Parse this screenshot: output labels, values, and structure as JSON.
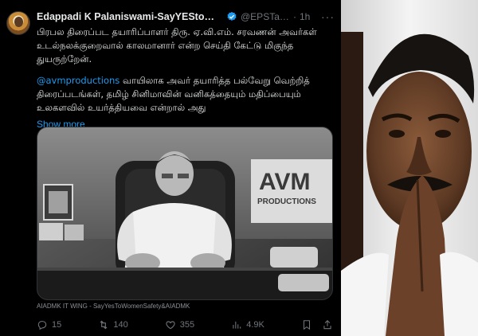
{
  "tweet": {
    "display_name": "Edappadi K Palaniswami-SayYEStoWomen...",
    "handle": "@EPSTam...",
    "separator": "·",
    "time": "1h",
    "more_icon": "more-horizontal-icon",
    "text_paragraph_1": "பிரபல திரைப்பட தயாரிப்பாளர் திரு. ஏ.வி.எம். சரவணன் அவர்கள் உடல்நலக்குறைவால் காலமானார் என்ற செய்தி கேட்டு மிகுந்த துயருற்றேன்.",
    "mention": "@avmproductions",
    "text_paragraph_2": " வாயிலாக அவர் தயாரித்த பல்வேறு வெற்றித் திரைப்படங்கள், தமிழ் சினிமாவின் வனிகத்தையும் மதிப்பையும் உலகளவில் உயர்த்தியவை என்றால் அது",
    "show_more": "Show more",
    "media": {
      "sign_text_1": "AVM",
      "sign_text_2": "PRODUCTIONS"
    },
    "media_caption": "AIADMK IT WING - SayYesToWomenSafety&AIADMK",
    "actions": {
      "reply_count": "15",
      "retweet_count": "140",
      "like_count": "355",
      "views_count": "4.9K"
    }
  },
  "colors": {
    "background": "#000000",
    "text": "#e7e9ea",
    "muted": "#71767b",
    "link": "#1d9bf0",
    "verified": "#1d9bf0"
  }
}
